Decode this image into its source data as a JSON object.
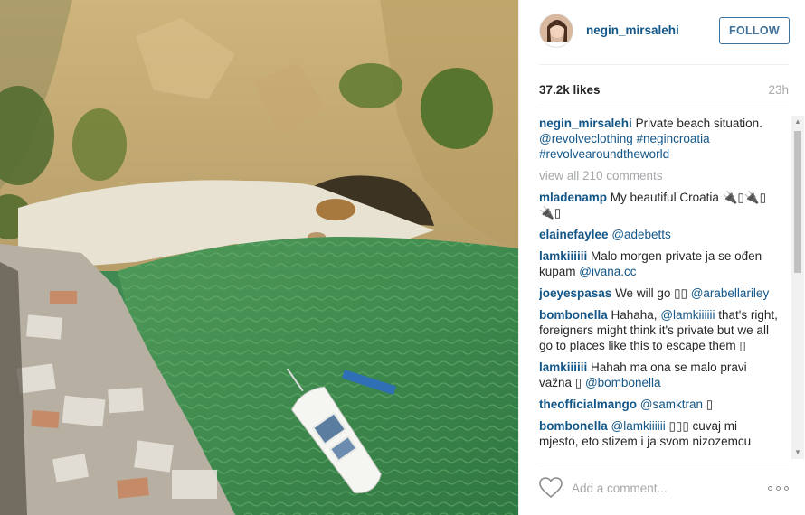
{
  "post": {
    "username": "negin_mirsalehi",
    "follow_label": "FOLLOW",
    "likes": "37.2k likes",
    "time": "23h",
    "caption": {
      "user": "negin_mirsalehi",
      "text": "Private beach situation.",
      "tags": [
        "@revolveclothing",
        "#negincroatia",
        "#revolvearoundtheworld"
      ]
    },
    "view_all": "view all 210 comments",
    "add_comment_placeholder": "Add a comment..."
  },
  "comments": [
    {
      "user": "mladenamp",
      "parts": [
        {
          "t": "text",
          "v": " My beautiful Croatia 🔌▯🔌▯ 🔌▯"
        }
      ]
    },
    {
      "user": "elainefaylee",
      "parts": [
        {
          "t": "link",
          "v": " @adebetts"
        }
      ]
    },
    {
      "user": "lamkiiiiii",
      "parts": [
        {
          "t": "text",
          "v": " Malo morgen private ja se ođen kupam "
        },
        {
          "t": "link",
          "v": "@ivana.cc"
        }
      ]
    },
    {
      "user": "joeyespasas",
      "parts": [
        {
          "t": "text",
          "v": " We will go ▯▯ "
        },
        {
          "t": "link",
          "v": "@arabellariley"
        }
      ]
    },
    {
      "user": "bombonella",
      "parts": [
        {
          "t": "text",
          "v": " Hahaha, "
        },
        {
          "t": "link",
          "v": "@lamkiiiiii"
        },
        {
          "t": "text",
          "v": " that's right, foreigners might think it's private but we all go to places like this to escape them ▯"
        }
      ]
    },
    {
      "user": "lamkiiiiii",
      "parts": [
        {
          "t": "text",
          "v": " Hahah ma ona se malo pravi važna ▯ "
        },
        {
          "t": "link",
          "v": "@bombonella"
        }
      ]
    },
    {
      "user": "theofficialmango",
      "parts": [
        {
          "t": "link",
          "v": " @samktran"
        },
        {
          "t": "text",
          "v": " ▯"
        }
      ]
    },
    {
      "user": "bombonella",
      "parts": [
        {
          "t": "link",
          "v": " @lamkiiiiii"
        },
        {
          "t": "text",
          "v": " ▯▯▯ cuvaj mi mjesto, eto stizem i ja svom nizozemcu"
        }
      ]
    }
  ],
  "icons": {
    "heart": "heart-icon",
    "more": "more-options-icon",
    "scroll_up": "scroll-up-arrow-icon",
    "scroll_down": "scroll-down-arrow-icon"
  },
  "colors": {
    "link": "#125688",
    "follow": "#3f729b",
    "muted": "#a5a7aa",
    "water": "#3f8a52"
  }
}
